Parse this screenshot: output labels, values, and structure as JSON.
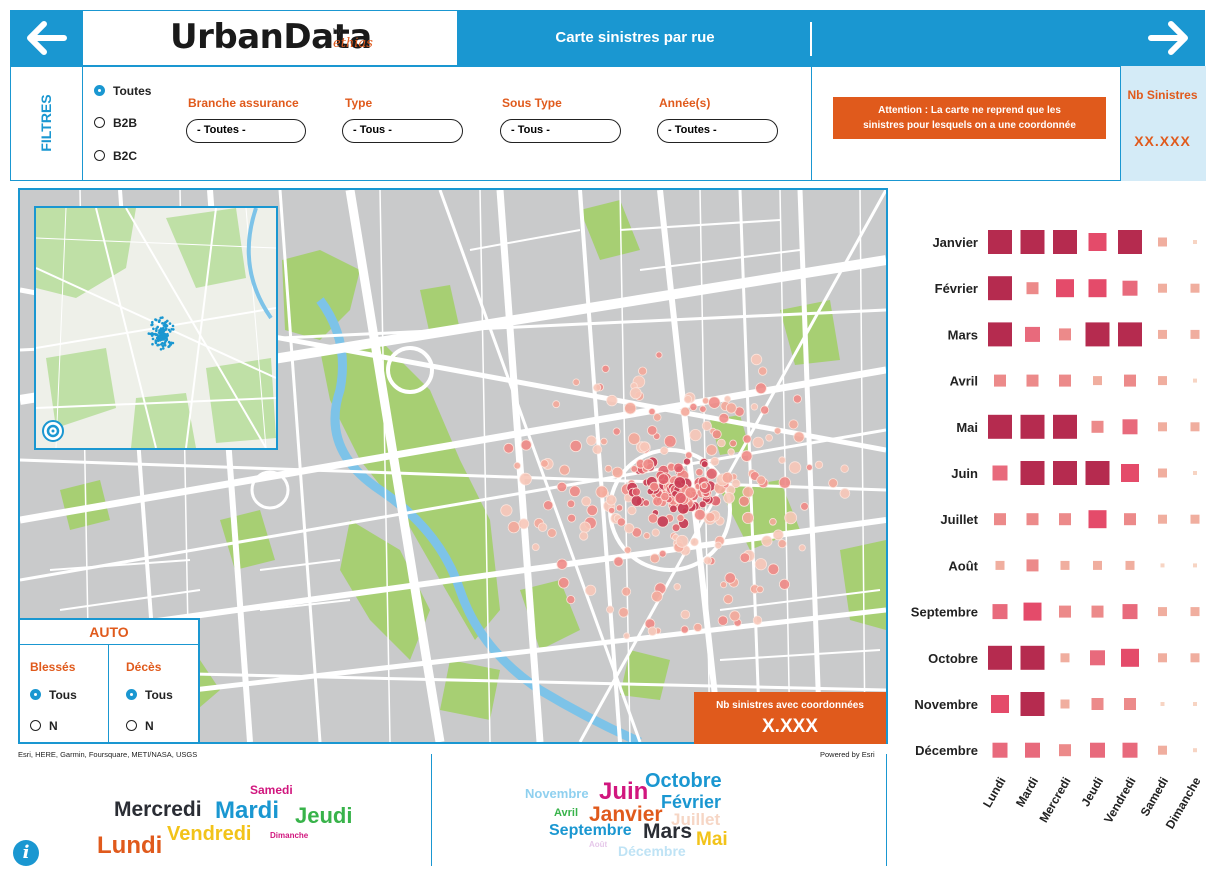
{
  "header": {
    "back_icon": "arrow-left-icon",
    "forward_icon": "arrow-right-icon",
    "logo_text": "UrbanData",
    "logo_by": "by",
    "logo_brand": "ethias",
    "title": "Carte sinistres par rue"
  },
  "filters": {
    "section_label": "FILTRES",
    "client_options": [
      {
        "label": "Toutes",
        "selected": true
      },
      {
        "label": "B2B",
        "selected": false
      },
      {
        "label": "B2C",
        "selected": false
      }
    ],
    "dropdowns": [
      {
        "label": "Branche assurance",
        "value": "- Toutes -"
      },
      {
        "label": "Type",
        "value": "- Tous -"
      },
      {
        "label": "Sous Type",
        "value": "- Tous -"
      },
      {
        "label": "Année(s)",
        "value": "- Toutes -"
      }
    ],
    "warning_line1": "Attention : La carte ne reprend que les",
    "warning_line2": "sinistres pour lesquels on a une coordonnée",
    "nb_sinistres_label": "Nb Sinistres",
    "nb_sinistres_value": "XX.XXX"
  },
  "map": {
    "auto_panel": {
      "title": "AUTO",
      "blesses_label": "Blessés",
      "deces_label": "Décès",
      "blesses_options": [
        {
          "label": "Tous",
          "selected": true
        },
        {
          "label": "N",
          "selected": false
        }
      ],
      "deces_options": [
        {
          "label": "Tous",
          "selected": true
        },
        {
          "label": "N",
          "selected": false
        }
      ]
    },
    "coord_label": "Nb sinistres avec coordonnées",
    "coord_value": "X.XXX",
    "attribution": "Esri, HERE, Garmin, Foursquare, METI/NASA, USGS",
    "powered_by": "Powered by Esri",
    "locate_icon": "locate-icon"
  },
  "wordcloud_days": [
    {
      "text": "Samedi",
      "color": "#d1167e"
    },
    {
      "text": "Mercredi",
      "color": "#2a2d34"
    },
    {
      "text": "Mardi",
      "color": "#1a97d1"
    },
    {
      "text": "Jeudi",
      "color": "#38b34a"
    },
    {
      "text": "Lundi",
      "color": "#e05a1c"
    },
    {
      "text": "Vendredi",
      "color": "#f2c31a"
    },
    {
      "text": "Dimanche",
      "color": "#d1167e"
    }
  ],
  "wordcloud_months": [
    {
      "text": "Novembre",
      "color": "#8fd0ef"
    },
    {
      "text": "Juin",
      "color": "#d1167e"
    },
    {
      "text": "Octobre",
      "color": "#1a97d1"
    },
    {
      "text": "Avril",
      "color": "#38b34a"
    },
    {
      "text": "Janvier",
      "color": "#e05a1c"
    },
    {
      "text": "Février",
      "color": "#1a97d1"
    },
    {
      "text": "Juillet",
      "color": "#f6d6c5"
    },
    {
      "text": "Septembre",
      "color": "#1a97d1"
    },
    {
      "text": "Mars",
      "color": "#2a2d34"
    },
    {
      "text": "Mai",
      "color": "#f2c31a"
    },
    {
      "text": "Août",
      "color": "#e6c8ea"
    },
    {
      "text": "Décembre",
      "color": "#bfe3f5"
    }
  ],
  "info_icon": "info-icon",
  "chart_data": {
    "type": "heatmap",
    "rows": [
      "Janvier",
      "Février",
      "Mars",
      "Avril",
      "Mai",
      "Juin",
      "Juillet",
      "Août",
      "Septembre",
      "Octobre",
      "Novembre",
      "Décembre"
    ],
    "columns": [
      "Lundi",
      "Mardi",
      "Mercredi",
      "Jeudi",
      "Vendredi",
      "Samedi",
      "Dimanche"
    ],
    "values": [
      [
        5,
        5,
        5,
        4,
        5,
        1,
        0
      ],
      [
        5,
        2,
        4,
        4,
        3,
        1,
        1
      ],
      [
        5,
        3,
        2,
        5,
        5,
        1,
        1
      ],
      [
        2,
        2,
        2,
        1,
        2,
        1,
        0
      ],
      [
        5,
        5,
        5,
        2,
        3,
        1,
        1
      ],
      [
        3,
        5,
        5,
        5,
        4,
        1,
        0
      ],
      [
        2,
        2,
        2,
        4,
        2,
        1,
        1
      ],
      [
        1,
        2,
        1,
        1,
        1,
        0,
        0
      ],
      [
        3,
        4,
        2,
        2,
        3,
        1,
        1
      ],
      [
        5,
        5,
        1,
        3,
        4,
        1,
        1
      ],
      [
        4,
        5,
        1,
        2,
        2,
        0,
        0
      ],
      [
        3,
        3,
        2,
        3,
        3,
        1,
        0
      ]
    ],
    "value_scale": "intensity 0-5",
    "colors": [
      "#f7d4c3",
      "#f0ae9f",
      "#ec8a8a",
      "#e86a7c",
      "#e44b6a",
      "#b52b4f"
    ]
  }
}
